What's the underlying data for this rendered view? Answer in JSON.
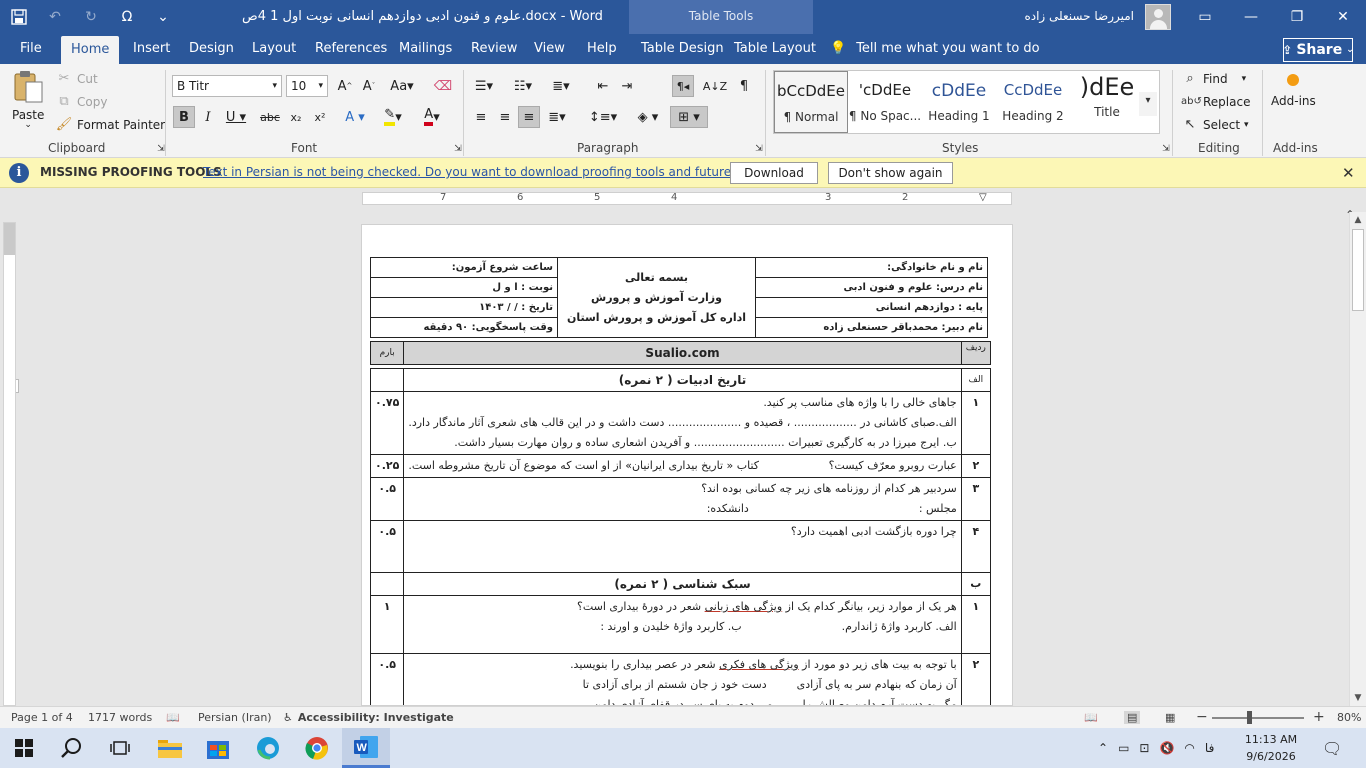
{
  "window": {
    "title": "علوم و فنون ادبی دوازدهم انسانی نوبت اول 1 4ص.docx  -  Word",
    "context_tab": "Table Tools",
    "user": "امیررضا حسنعلی زاده",
    "qat": [
      "save-icon",
      "undo-icon",
      "redo-icon",
      "symbol-icon",
      "customize-icon"
    ]
  },
  "tabs": [
    "File",
    "Home",
    "Insert",
    "Design",
    "Layout",
    "References",
    "Mailings",
    "Review",
    "View",
    "Help",
    "Table Design",
    "Table Layout"
  ],
  "active_tab": "Home",
  "tell_me": "Tell me what you want to do",
  "share": "Share",
  "clipboard": {
    "paste": "Paste",
    "cut": "Cut",
    "copy": "Copy",
    "format_painter": "Format Painter",
    "label": "Clipboard"
  },
  "font": {
    "name": "B Titr",
    "size": "10",
    "label": "Font"
  },
  "paragraph": {
    "label": "Paragraph"
  },
  "styles": {
    "label": "Styles",
    "items": [
      {
        "preview": "bCcDdEe",
        "name": "¶ Normal"
      },
      {
        "preview": "'cDdEe",
        "name": "¶ No Spac..."
      },
      {
        "preview": "cDdEe",
        "name": "Heading 1"
      },
      {
        "preview": "CcDdEe",
        "name": "Heading 2"
      },
      {
        "preview": ")dEe",
        "name": "Title"
      }
    ]
  },
  "editing": {
    "find": "Find",
    "replace": "Replace",
    "select": "Select",
    "label": "Editing"
  },
  "addins": {
    "button": "Add-ins",
    "label": "Add-ins"
  },
  "message": {
    "title": "MISSING PROOFING TOOLS",
    "text": "Text in Persian is not being checked. Do you want to download proofing tools and future updates?",
    "download": "Download",
    "dont_show": "Don't show again"
  },
  "ruler": [
    "7",
    "6",
    "5",
    "4",
    "3",
    "2",
    "1"
  ],
  "document": {
    "header": {
      "student_name": "نام و نام خانوادگی:",
      "course": "نام درس: علوم و فنون ادبی",
      "grade": "پایه : دوازدهم انسانی",
      "teacher": "نام دبیر: محمدباقر حسنعلی زاده",
      "bismillah": "بسمه تعالی",
      "ministry": "وزارت آموزش و پرورش",
      "office": "اداره کل آموزش و پرورش استان",
      "start_time": "ساعت شروع آزمون:",
      "turn": "نوبت : ا و ل",
      "date": "تاریخ : / / ۱۴۰۳",
      "duration": "وقت پاسخگویی: ۹۰ دقیقه"
    },
    "col_header": {
      "num": "ردیف",
      "site": "Sualio.com",
      "score": "بارم"
    },
    "section_a": {
      "letter": "الف",
      "title": "تاریخ ادبیات ( ۲ نمره)"
    },
    "q1": {
      "num": "۱",
      "score": "۰.۷۵",
      "lines": [
        "جاهای خالی را با واژه های مناسب پر کنید.",
        "الف.صبای کاشانی در .................. ، قصیده و ..................... دست داشت و در این قالب های شعری آثار ماندگار دارد.",
        "ب. ایرج میرزا در به کارگیری تعبیرات .......................... و آفریدن اشعاری ساده و روان مهارت بسیار داشت."
      ]
    },
    "q2": {
      "num": "۲",
      "score": "۰.۲۵",
      "left": "عبارت روبرو معرّف کیست؟",
      "right": "کتاب « تاریخ بیداری ایرانیان» از او است که موضوع آن تاریخ مشروطه است."
    },
    "q3": {
      "num": "۳",
      "score": "۰.۵",
      "text": "سردبیر هر کدام از روزنامه های زیر چه کسانی بوده اند؟",
      "a": "مجلس :",
      "b": "دانشکده:"
    },
    "q4": {
      "num": "۴",
      "score": "۰.۵",
      "text": "چرا دوره بازگشت ادبی اهمیت دارد؟"
    },
    "section_b": {
      "letter": "ب",
      "title": "سبک شناسی ( ۲ نمره)"
    },
    "q5": {
      "num": "۱",
      "score": "۱",
      "text_pre": "هر یک از موارد زیر، بیانگر کدام یک از ",
      "text_ul": "ویژگی های زبانی",
      "text_post": " شعر در دورۀ بیداری است؟",
      "a": "الف. کاربرد واژۀ ژاندارم.",
      "b": "ب. کاربرد واژۀ خلیدن و اورند :"
    },
    "q6": {
      "num": "۲",
      "score": "۰.۵",
      "text_pre": "با توجه به بیت های زیر دو مورد از ",
      "text_ul": "ویژگی های فکری",
      "text_post": " شعر در عصر بیداری را بنویسید.",
      "v1a": "آن زمان که بنهادم سر به پای آزادی",
      "v1b": "دست خود ز جان شستم از برای آزادی تا",
      "v2a": "مگر به دست آرم دامن وصالش را",
      "v2b": "می دوم به پای سر در قفای آزادی دامن"
    }
  },
  "status": {
    "page": "Page 1 of 4",
    "words": "1717 words",
    "language": "Persian (Iran)",
    "accessibility": "Accessibility: Investigate",
    "zoom": "80%",
    "zoom_level": 0.4
  },
  "taskbar": {
    "time": "11:13 AM",
    "date": "9/6/2026",
    "lang": "فا"
  }
}
